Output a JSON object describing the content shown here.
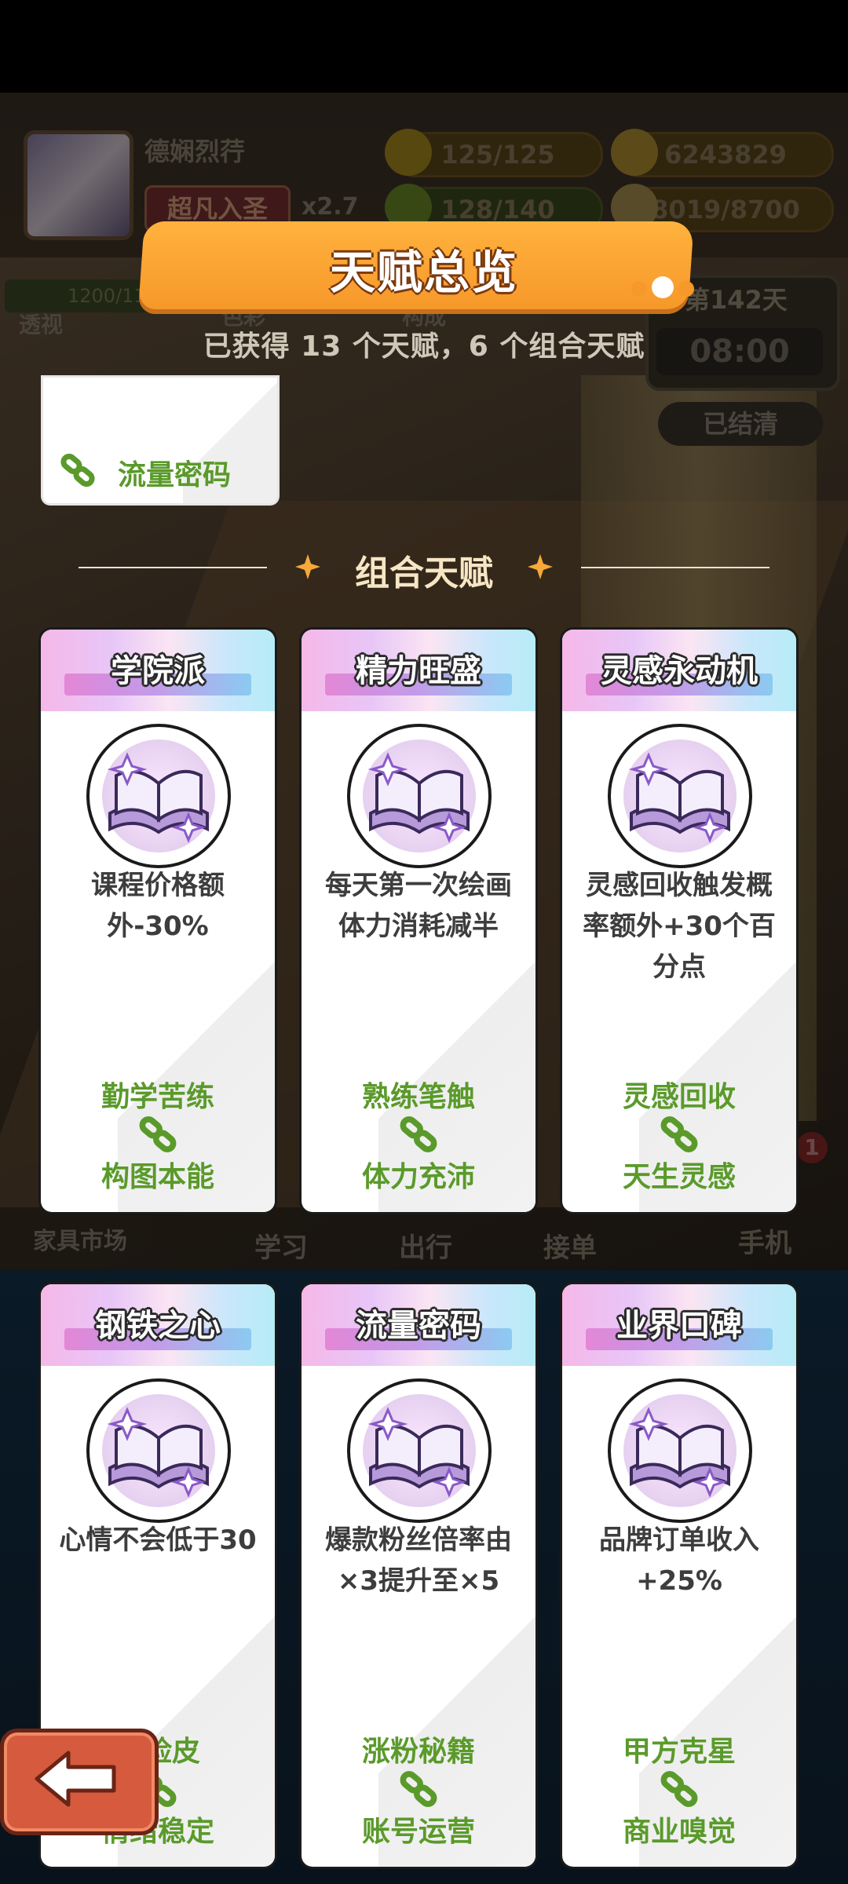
{
  "hud": {
    "player_name": "德娴烈荇",
    "rank": "超凡入圣",
    "multiplier": "x2.7",
    "energy": "125/125",
    "coins": "6243829",
    "health": "128/140",
    "ideas": "8019/8700",
    "left_stat": "1200/1100",
    "left_label": "透视",
    "day": "第142天",
    "time": "08:00",
    "settled": "已结清"
  },
  "background_labels": {
    "color": "色彩",
    "composition": "构成",
    "furniture_market": "家具市场",
    "study": "学习",
    "travel": "出行",
    "orders": "接单",
    "phone": "手机",
    "notification_count": "1"
  },
  "header": {
    "title": "天赋总览",
    "subtitle": "已获得 13 个天赋，6 个组合天赋"
  },
  "partial_card": {
    "label": "流量密码"
  },
  "section": {
    "title": "组合天赋"
  },
  "cards": [
    {
      "name": "学院派",
      "desc": "课程价格额外-30%",
      "combo_a": "勤学苦练",
      "combo_b": "构图本能"
    },
    {
      "name": "精力旺盛",
      "desc": "每天第一次绘画体力消耗减半",
      "combo_a": "熟练笔触",
      "combo_b": "体力充沛"
    },
    {
      "name": "灵感永动机",
      "desc": "灵感回收触发概率额外+30个百分点",
      "combo_a": "灵感回收",
      "combo_b": "天生灵感"
    },
    {
      "name": "钢铁之心",
      "desc": "心情不会低于30",
      "combo_a": "厚脸皮",
      "combo_b": "情绪稳定"
    },
    {
      "name": "流量密码",
      "desc": "爆款粉丝倍率由×3提升至×5",
      "combo_a": "涨粉秘籍",
      "combo_b": "账号运营"
    },
    {
      "name": "业界口碑",
      "desc": "品牌订单收入+25%",
      "combo_a": "甲方克星",
      "combo_b": "商业嗅觉"
    }
  ],
  "colors": {
    "banner": "#f6982a",
    "combo_text": "#5a9a2a",
    "back_button": "#d65a3e"
  },
  "icons": {
    "back": "back-arrow-icon",
    "link": "chain-link-icon",
    "talent": "open-book-icon"
  }
}
